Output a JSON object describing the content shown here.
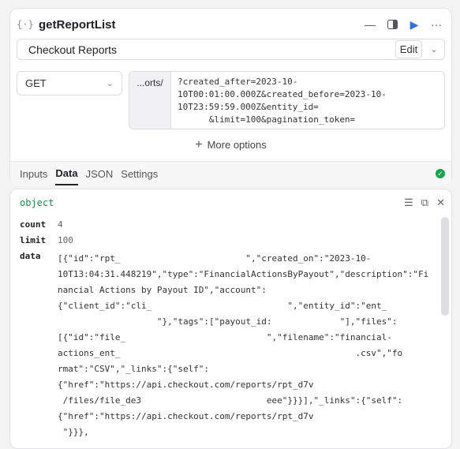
{
  "header": {
    "code_icon": "{·}",
    "title": "getReportList",
    "icons": [
      "minus-icon",
      "panel-icon",
      "play-icon",
      "more-icon"
    ]
  },
  "resource": {
    "name": "Checkout Reports",
    "edit_label": "Edit"
  },
  "request": {
    "method": "GET",
    "url_prefix": "...orts/",
    "url_query": "?created_after=2023-10-\n10T00:01:00.000Z&created_before=2023-10-\n10T23:59:59.000Z&entity_id=\n      &limit=100&pagination_token="
  },
  "more_options_label": "More options",
  "tabs": [
    "Inputs",
    "Data",
    "JSON",
    "Settings"
  ],
  "active_tab": "Data",
  "result": {
    "type_label": "object",
    "count_key": "count",
    "count_value": "4",
    "limit_key": "limit",
    "limit_value": "100",
    "data_key": "data",
    "data_value": "[{\"id\":\"rpt_                        \",\"created_on\":\"2023-10-\n10T13:04:31.448219\",\"type\":\"FinancialActionsByPayout\",\"description\":\"Fi\nnancial Actions by Payout ID\",\"account\":\n{\"client_id\":\"cli_                          \",\"entity_id\":\"ent_\n                   \"},\"tags\":[\"payout_id:             \"],\"files\":\n[{\"id\":\"file_                           \",\"filename\":\"financial-\nactions_ent_                                             .csv\",\"fo\nrmat\":\"CSV\",\"_links\":{\"self\":\n{\"href\":\"https://api.checkout.com/reports/rpt_d7v\n /files/file_de3                        eee\"}}}],\"_links\":{\"self\":\n{\"href\":\"https://api.checkout.com/reports/rpt_d7v\n \"}}},"
  },
  "colors": {
    "accent": "#2f6fe0",
    "success": "#16a34a",
    "type_green": "#1f8a4c"
  }
}
